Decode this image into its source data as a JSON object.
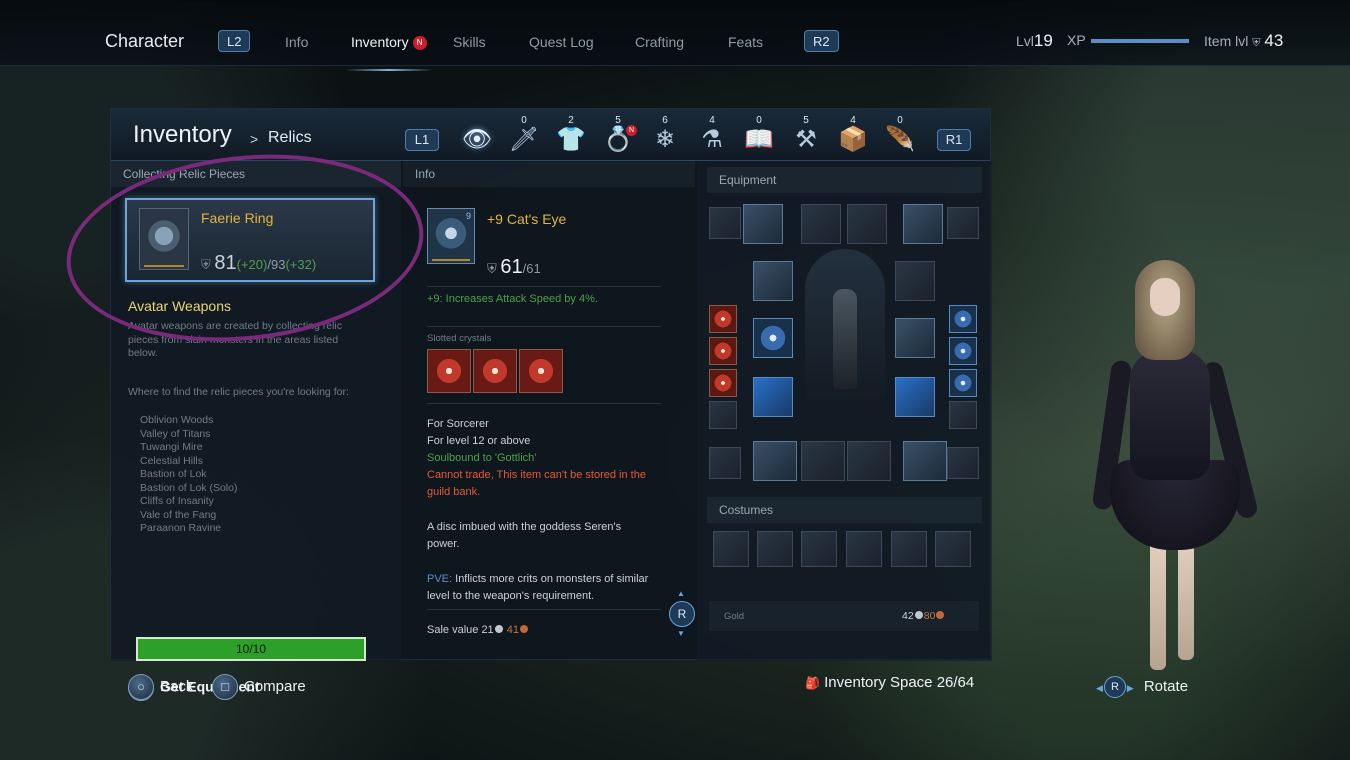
{
  "topnav": {
    "title": "Character",
    "l2": "L2",
    "r2": "R2",
    "tabs": [
      "Info",
      "Inventory",
      "Skills",
      "Quest Log",
      "Crafting",
      "Feats"
    ],
    "active_tab": "Inventory",
    "new_badge": "N",
    "level_label": "Lvl",
    "level_value": "19",
    "xp_label": "XP",
    "xp_fraction": 1.0,
    "item_level_label": "Item lvl",
    "item_level_value": "43"
  },
  "panel": {
    "title": "Inventory",
    "separator": ">",
    "subtitle": "Relics",
    "l1": "L1",
    "r1": "R1",
    "categories": [
      {
        "icon": "eye-icon",
        "count": "",
        "glyph": "👁"
      },
      {
        "icon": "sword-icon",
        "count": "0",
        "glyph": "🗡"
      },
      {
        "icon": "armor-icon",
        "count": "2",
        "glyph": "👕"
      },
      {
        "icon": "ring-icon",
        "count": "5",
        "glyph": "💍",
        "badge": "N"
      },
      {
        "icon": "gear-icon",
        "count": "6",
        "glyph": "❄"
      },
      {
        "icon": "potion-icon",
        "count": "4",
        "glyph": "⚗"
      },
      {
        "icon": "book-icon",
        "count": "0",
        "glyph": "📖"
      },
      {
        "icon": "anvil-icon",
        "count": "5",
        "glyph": "⚒"
      },
      {
        "icon": "box-icon",
        "count": "4",
        "glyph": "📦"
      },
      {
        "icon": "feather-icon",
        "count": "0",
        "glyph": "🪶"
      }
    ]
  },
  "left": {
    "header": "Collecting Relic Pieces",
    "relic_name": "Faerie Ring",
    "relic_value": "81",
    "relic_bonus1": "(+20)",
    "relic_max": "/93",
    "relic_bonus2": "(+32)",
    "aw_title": "Avatar Weapons",
    "aw_desc": "Avatar weapons are created by collecting relic pieces from slain monsters in the areas listed below.",
    "aw_where": "Where to find the relic pieces you're looking for:",
    "locations": [
      "Oblivion Woods",
      "Valley of Titans",
      "Tuwangi Mire",
      "Celestial Hills",
      "Bastion of Lok",
      "Bastion of Lok (Solo)",
      "Cliffs of Insanity",
      "Vale of the Fang",
      "Paraanon Ravine"
    ],
    "progress_text": "10/10",
    "progress_fraction": 1.0,
    "get_equipment": "Get Equipment"
  },
  "middle": {
    "header": "Info",
    "item_name": "+9 Cat's Eye",
    "item_plus": "9",
    "item_value": "61",
    "item_max": "/61",
    "bonus": "+9: Increases Attack Speed by 4%.",
    "slotted_label": "Slotted crystals",
    "for_class": "For Sorcerer",
    "for_level": "For level 12 or above",
    "soulbound": "Soulbound to 'Gottlich'",
    "cannot_trade": "Cannot trade, This item can't be stored in the guild bank.",
    "description": "A disc imbued with the goddess Seren's power.",
    "pve_label": "PVE:",
    "pve_text": " Inflicts more crits on monsters of similar level to the weapon's requirement.",
    "sale_label": "Sale value",
    "sale_silver": "21",
    "sale_copper": "41",
    "r_button": "R"
  },
  "right": {
    "header": "Equipment",
    "costumes_header": "Costumes",
    "gold_label": "Gold",
    "gold_silver": "42",
    "gold_copper": "80"
  },
  "bottom": {
    "back": "Back",
    "compare": "Compare",
    "inventory_space": "Inventory Space 26/64",
    "rotate": "Rotate",
    "rotate_btn": "R"
  }
}
